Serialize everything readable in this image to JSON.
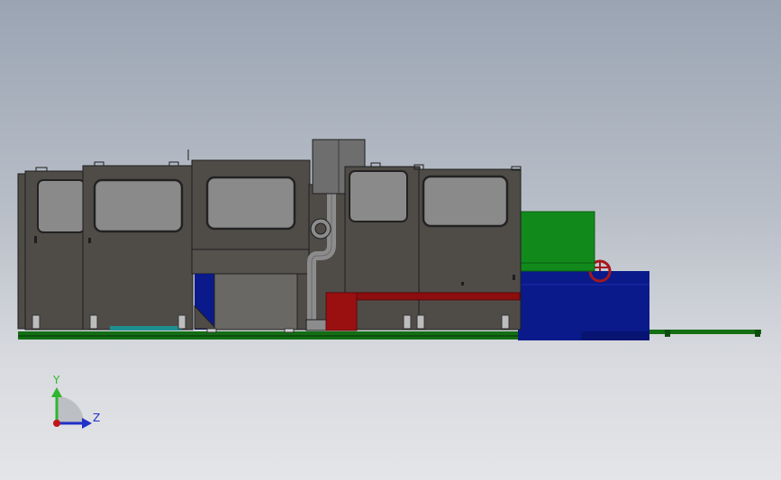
{
  "viewport": {
    "background_top": "#9aa4b3",
    "background_bottom": "#e4e5e8"
  },
  "colors": {
    "housing": "#4f4c48",
    "housing_light": "#5a5753",
    "window_glass": "#8a8a8a",
    "window_frame": "#222222",
    "control_box": "#6e6e6e",
    "duct": "#8c8c8c",
    "green_box": "#118a1b",
    "blue_base": "#0a1a8a",
    "red_part": "#8c0e0e",
    "rail_green": "#136e14",
    "cyan_strip": "#1f8f8f",
    "axis_y": "#2fb52f",
    "axis_z": "#2030c8",
    "axis_origin": "#c0161a"
  },
  "triad": {
    "y_label": "Y",
    "z_label": "Z",
    "y_icon": "axis-y-arrow",
    "z_icon": "axis-z-arrow",
    "origin_icon": "axis-origin"
  }
}
